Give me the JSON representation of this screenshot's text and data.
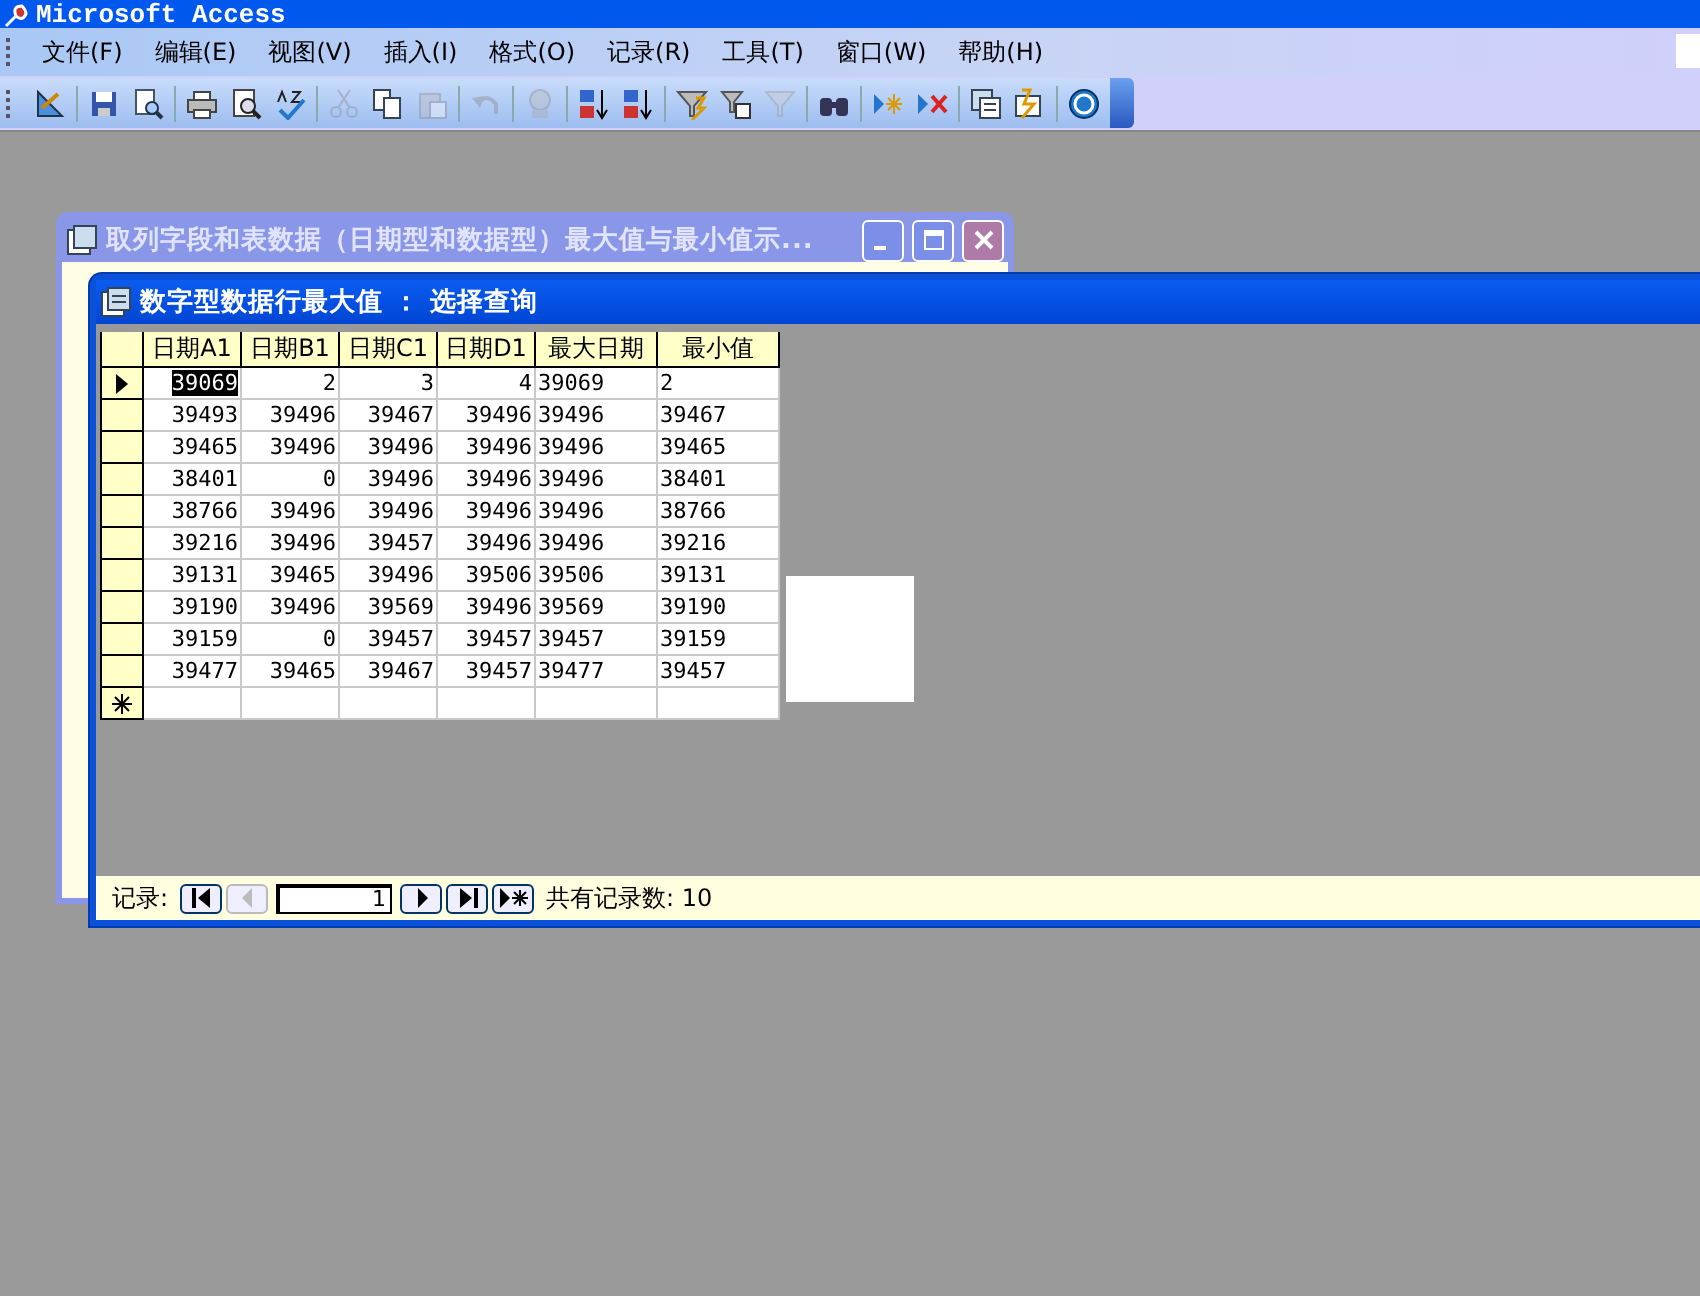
{
  "app_title": "Microsoft Access",
  "menu": [
    "文件(F)",
    "编辑(E)",
    "视图(V)",
    "插入(I)",
    "格式(O)",
    "记录(R)",
    "工具(T)",
    "窗口(W)",
    "帮助(H)"
  ],
  "toolbar": [
    {
      "kind": "design",
      "disabled": false
    },
    {
      "kind": "separator"
    },
    {
      "kind": "save",
      "disabled": false
    },
    {
      "kind": "file-search",
      "disabled": false
    },
    {
      "kind": "separator"
    },
    {
      "kind": "print",
      "disabled": false
    },
    {
      "kind": "preview",
      "disabled": false
    },
    {
      "kind": "spelling",
      "disabled": false
    },
    {
      "kind": "separator"
    },
    {
      "kind": "cut",
      "disabled": true
    },
    {
      "kind": "copy",
      "disabled": false
    },
    {
      "kind": "paste",
      "disabled": true
    },
    {
      "kind": "separator"
    },
    {
      "kind": "undo",
      "disabled": true
    },
    {
      "kind": "separator"
    },
    {
      "kind": "link",
      "disabled": true
    },
    {
      "kind": "separator"
    },
    {
      "kind": "sort-asc",
      "disabled": false
    },
    {
      "kind": "sort-desc",
      "disabled": false
    },
    {
      "kind": "separator"
    },
    {
      "kind": "filter-selection",
      "disabled": false
    },
    {
      "kind": "filter-form",
      "disabled": false
    },
    {
      "kind": "filter-apply",
      "disabled": true
    },
    {
      "kind": "separator"
    },
    {
      "kind": "find",
      "disabled": false
    },
    {
      "kind": "separator"
    },
    {
      "kind": "new-record",
      "disabled": false
    },
    {
      "kind": "delete-record",
      "disabled": false
    },
    {
      "kind": "separator"
    },
    {
      "kind": "database-window",
      "disabled": false
    },
    {
      "kind": "new-object",
      "disabled": false
    },
    {
      "kind": "separator"
    },
    {
      "kind": "help",
      "disabled": false
    }
  ],
  "back_window": {
    "title": "取列字段和表数据（日期型和数据型）最大值与最小值示...",
    "active": false
  },
  "query_window": {
    "title": "数字型数据行最大值 ： 选择查询",
    "active": true,
    "columns": [
      {
        "label": "日期A1",
        "kind": "number"
      },
      {
        "label": "日期B1",
        "kind": "number"
      },
      {
        "label": "日期C1",
        "kind": "number"
      },
      {
        "label": "日期D1",
        "kind": "number"
      },
      {
        "label": "最大日期",
        "kind": "text"
      },
      {
        "label": "最小值",
        "kind": "text"
      }
    ],
    "rows": [
      {
        "current": true,
        "cells": [
          {
            "text": "39069",
            "selected": true
          },
          {
            "text": "2",
            "selected": false
          },
          {
            "text": "3",
            "selected": false
          },
          {
            "text": "4",
            "selected": false
          },
          {
            "text": "39069",
            "selected": false
          },
          {
            "text": "2",
            "selected": false
          }
        ]
      },
      {
        "current": false,
        "cells": [
          {
            "text": "39493",
            "selected": false
          },
          {
            "text": "39496",
            "selected": false
          },
          {
            "text": "39467",
            "selected": false
          },
          {
            "text": "39496",
            "selected": false
          },
          {
            "text": "39496",
            "selected": false
          },
          {
            "text": "39467",
            "selected": false
          }
        ]
      },
      {
        "current": false,
        "cells": [
          {
            "text": "39465",
            "selected": false
          },
          {
            "text": "39496",
            "selected": false
          },
          {
            "text": "39496",
            "selected": false
          },
          {
            "text": "39496",
            "selected": false
          },
          {
            "text": "39496",
            "selected": false
          },
          {
            "text": "39465",
            "selected": false
          }
        ]
      },
      {
        "current": false,
        "cells": [
          {
            "text": "38401",
            "selected": false
          },
          {
            "text": "0",
            "selected": false
          },
          {
            "text": "39496",
            "selected": false
          },
          {
            "text": "39496",
            "selected": false
          },
          {
            "text": "39496",
            "selected": false
          },
          {
            "text": "38401",
            "selected": false
          }
        ]
      },
      {
        "current": false,
        "cells": [
          {
            "text": "38766",
            "selected": false
          },
          {
            "text": "39496",
            "selected": false
          },
          {
            "text": "39496",
            "selected": false
          },
          {
            "text": "39496",
            "selected": false
          },
          {
            "text": "39496",
            "selected": false
          },
          {
            "text": "38766",
            "selected": false
          }
        ]
      },
      {
        "current": false,
        "cells": [
          {
            "text": "39216",
            "selected": false
          },
          {
            "text": "39496",
            "selected": false
          },
          {
            "text": "39457",
            "selected": false
          },
          {
            "text": "39496",
            "selected": false
          },
          {
            "text": "39496",
            "selected": false
          },
          {
            "text": "39216",
            "selected": false
          }
        ]
      },
      {
        "current": false,
        "cells": [
          {
            "text": "39131",
            "selected": false
          },
          {
            "text": "39465",
            "selected": false
          },
          {
            "text": "39496",
            "selected": false
          },
          {
            "text": "39506",
            "selected": false
          },
          {
            "text": "39506",
            "selected": false
          },
          {
            "text": "39131",
            "selected": false
          }
        ]
      },
      {
        "current": false,
        "cells": [
          {
            "text": "39190",
            "selected": false
          },
          {
            "text": "39496",
            "selected": false
          },
          {
            "text": "39569",
            "selected": false
          },
          {
            "text": "39496",
            "selected": false
          },
          {
            "text": "39569",
            "selected": false
          },
          {
            "text": "39190",
            "selected": false
          }
        ]
      },
      {
        "current": false,
        "cells": [
          {
            "text": "39159",
            "selected": false
          },
          {
            "text": "0",
            "selected": false
          },
          {
            "text": "39457",
            "selected": false
          },
          {
            "text": "39457",
            "selected": false
          },
          {
            "text": "39457",
            "selected": false
          },
          {
            "text": "39159",
            "selected": false
          }
        ]
      },
      {
        "current": false,
        "cells": [
          {
            "text": "39477",
            "selected": false
          },
          {
            "text": "39465",
            "selected": false
          },
          {
            "text": "39467",
            "selected": false
          },
          {
            "text": "39457",
            "selected": false
          },
          {
            "text": "39477",
            "selected": false
          },
          {
            "text": "39457",
            "selected": false
          }
        ]
      }
    ],
    "navigation": {
      "label": "记录:",
      "record": "1",
      "prev_disabled": true,
      "total": "共有记录数: 10"
    }
  }
}
